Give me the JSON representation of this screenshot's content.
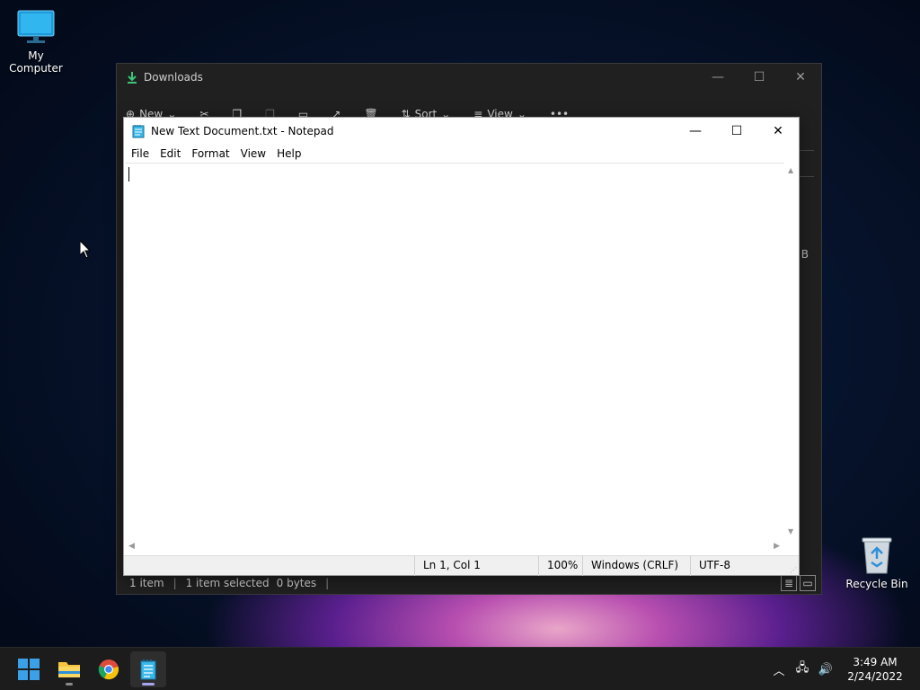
{
  "desktop": {
    "icons": [
      {
        "label": "My Computer"
      },
      {
        "label": "Recycle Bin"
      }
    ]
  },
  "explorer": {
    "title": "Downloads",
    "toolbar": {
      "new": "New",
      "sort": "Sort",
      "view": "View"
    },
    "side_fragment": "B",
    "status": {
      "items": "1 item",
      "selected": "1 item selected",
      "size": "0 bytes"
    }
  },
  "notepad": {
    "title": "New Text Document.txt - Notepad",
    "menu": [
      "File",
      "Edit",
      "Format",
      "View",
      "Help"
    ],
    "status": {
      "position": "Ln 1, Col 1",
      "zoom": "100%",
      "line_ending": "Windows (CRLF)",
      "encoding": "UTF-8"
    }
  },
  "taskbar": {
    "apps": [
      "start-icon",
      "file-explorer-icon",
      "chrome-icon",
      "notepad-icon"
    ],
    "clock": {
      "time": "3:49 AM",
      "date": "2/24/2022"
    }
  },
  "colors": {
    "accent": "#0078d4",
    "notepad_active_indicator": "#a5a5f0"
  }
}
